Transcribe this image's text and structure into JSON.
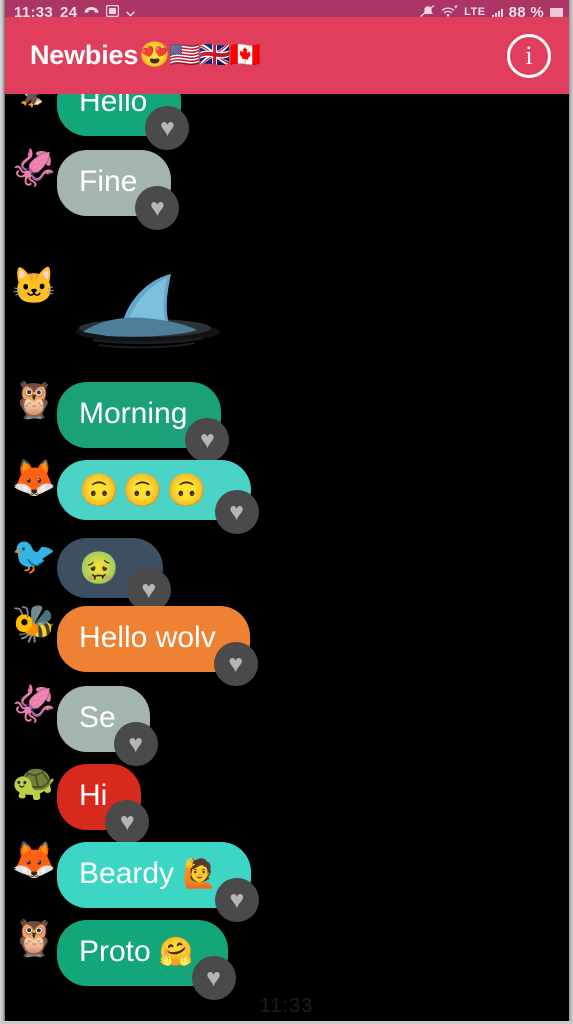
{
  "statusbar": {
    "time": "11:33",
    "notification_count": "24",
    "call_icon": "phone-handset-icon",
    "sim_icon": "sim-card-icon",
    "dropdown_icon": "chevron-down-icon",
    "mute_icon": "bell-muted-icon",
    "wifi_calling_icon": "wifi-calling-icon",
    "network_type": "LTE",
    "signal_icon": "signal-bars-icon",
    "battery_percent": "88 %",
    "battery_icon": "battery-icon",
    "background": "#ab3564"
  },
  "appbar": {
    "title_text": "Newbies",
    "title_emojis": "😍🇺🇸🇬🇧🇨🇦",
    "info_icon": "info-circle-icon",
    "info_glyph": "i",
    "background": "#e03e5c"
  },
  "conversation": {
    "background": "#000000",
    "bottom_clock": "11:33",
    "reaction_glyph": "♥",
    "messages": [
      {
        "avatar": "🦅",
        "avatar_name": "eagle-avatar",
        "type": "text",
        "text": "Hello",
        "bubble_color": "#12a67a",
        "reaction": "♥",
        "clipped": true
      },
      {
        "avatar": "🦑",
        "avatar_name": "squid-avatar",
        "type": "text",
        "text": "Fine",
        "bubble_color": "#a4b5af",
        "reaction": "♥"
      },
      {
        "avatar": "🐱",
        "avatar_name": "cat-avatar",
        "type": "sticker",
        "sticker_name": "shark-fin-sticker",
        "text": "",
        "bubble_color": "transparent",
        "reaction": ""
      },
      {
        "avatar": "🦉",
        "avatar_name": "owl-detective-avatar",
        "type": "text",
        "text": "Morning",
        "bubble_color": "#1aa179",
        "reaction": "♥"
      },
      {
        "avatar": "🦊",
        "avatar_name": "fox-balloon-avatar",
        "type": "emoji",
        "text": "🙃🙃🙃",
        "bubble_color": "#4bd3c6",
        "reaction": "♥"
      },
      {
        "avatar": "🐦",
        "avatar_name": "red-hair-bird-avatar",
        "type": "emoji",
        "text": "🤢",
        "bubble_color": "#3d4f61",
        "reaction": "♥"
      },
      {
        "avatar": "🐝",
        "avatar_name": "bee-avatar",
        "type": "text",
        "text": "Hello wolv",
        "bubble_color": "#ef8232",
        "reaction": "♥"
      },
      {
        "avatar": "🦑",
        "avatar_name": "squid-avatar",
        "type": "text",
        "text": "Se",
        "bubble_color": "#a4b5af",
        "reaction": "♥"
      },
      {
        "avatar": "🐢",
        "avatar_name": "turtle-avatar",
        "type": "text",
        "text": "Hi",
        "bubble_color": "#d8291f",
        "reaction": "♥"
      },
      {
        "avatar": "🦊",
        "avatar_name": "fox-balloon-avatar",
        "type": "text",
        "text": "Beardy",
        "trailing_emoji": "🙋",
        "bubble_color": "#3dd6c4",
        "reaction": "♥"
      },
      {
        "avatar": "🦉",
        "avatar_name": "owl-detective-avatar",
        "type": "text",
        "text": "Proto",
        "trailing_emoji": "🤗",
        "bubble_color": "#12a67a",
        "reaction": "♥"
      }
    ]
  }
}
